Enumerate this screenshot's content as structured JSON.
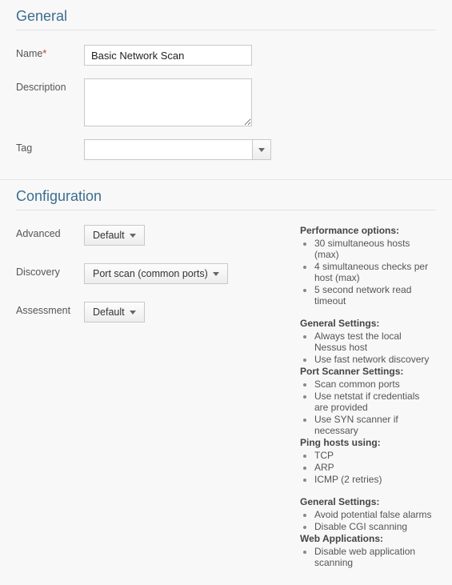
{
  "general": {
    "title": "General",
    "name_label": "Name",
    "name_value": "Basic Network Scan",
    "description_label": "Description",
    "description_value": "",
    "tag_label": "Tag",
    "tag_value": ""
  },
  "configuration": {
    "title": "Configuration",
    "advanced_label": "Advanced",
    "advanced_value": "Default",
    "discovery_label": "Discovery",
    "discovery_value": "Port scan (common ports)",
    "assessment_label": "Assessment",
    "assessment_value": "Default"
  },
  "info": {
    "performance": {
      "heading": "Performance options:",
      "items": [
        "30 simultaneous hosts (max)",
        "4 simultaneous checks per host (max)",
        "5 second network read timeout"
      ]
    },
    "general_settings_1": {
      "heading": "General Settings:",
      "items": [
        "Always test the local Nessus host",
        "Use fast network discovery"
      ]
    },
    "port_scanner": {
      "heading": "Port Scanner Settings:",
      "items": [
        "Scan common ports",
        "Use netstat if credentials are provided",
        "Use SYN scanner if necessary"
      ]
    },
    "ping_hosts": {
      "heading": "Ping hosts using:",
      "items": [
        "TCP",
        "ARP",
        "ICMP (2 retries)"
      ]
    },
    "general_settings_2": {
      "heading": "General Settings:",
      "items": [
        "Avoid potential false alarms",
        "Disable CGI scanning"
      ]
    },
    "web_apps": {
      "heading": "Web Applications:",
      "items": [
        "Disable web application scanning"
      ]
    }
  }
}
